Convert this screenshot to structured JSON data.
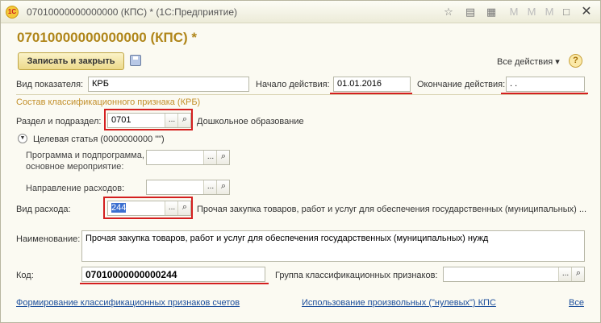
{
  "window": {
    "title": "07010000000000000 (КПС) * (1С:Предприятие)",
    "app_logo_text": "1С"
  },
  "heading": "07010000000000000 (КПС) *",
  "toolbar": {
    "save_close_label": "Записать и закрыть",
    "all_actions_label": "Все действия ▾",
    "help_label": "?"
  },
  "form": {
    "indicator_type_label": "Вид показателя:",
    "indicator_type_value": "КРБ",
    "start_label": "Начало действия:",
    "start_value": "01.01.2016",
    "end_label": "Окончание действия:",
    "end_value": " . .",
    "section_title": "Состав классификационного признака (КРБ)",
    "razdel_label": "Раздел и подраздел:",
    "razdel_value": "0701",
    "razdel_desc": "Дошкольное образование",
    "target_article_label": "Целевая статья (0000000000 \"\")",
    "program_label_1": "Программа и подпрограмма,",
    "program_label_2": "основное мероприятие:",
    "program_value": "",
    "direction_label": "Направление расходов:",
    "direction_value": "",
    "expense_type_label": "Вид расхода:",
    "expense_type_value": "244",
    "expense_type_desc": "Прочая закупка товаров, работ и услуг для обеспечения государственных (муниципальных) ...",
    "name_label": "Наименование:",
    "name_value": "Прочая закупка товаров, работ и услуг для обеспечения государственных (муниципальных) нужд",
    "code_label": "Код:",
    "code_value": "07010000000000244",
    "group_label": "Группа классификационных признаков:",
    "group_value": ""
  },
  "footer": {
    "link_forming": "Формирование классификационных признаков счетов",
    "link_zero": "Использование произвольных (\"нулевых\") КПС",
    "link_all": "Все"
  },
  "icons": {
    "dots": "...",
    "magnifier": "🔍",
    "collapse": "▼",
    "disk": "disk"
  },
  "colors": {
    "heading": "#b0861a",
    "highlight": "#d41f1f",
    "link": "#1d4f9c"
  }
}
